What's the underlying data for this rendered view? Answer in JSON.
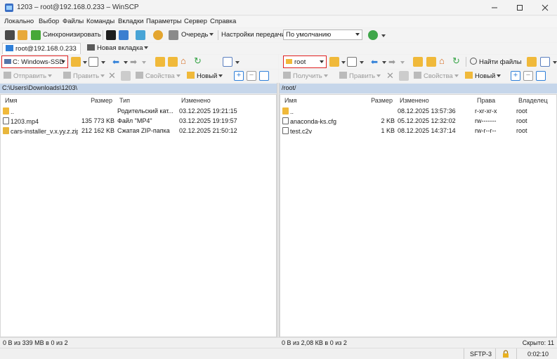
{
  "window": {
    "title": "1203 – root@192.168.0.233 – WinSCP",
    "controls": [
      "minimize",
      "maximize",
      "close"
    ]
  },
  "menu": [
    "Локально",
    "Выбор",
    "Файлы",
    "Команды",
    "Вкладки",
    "Параметры",
    "Сервер",
    "Справка"
  ],
  "toolbar": {
    "sync_label": "Синхронизировать",
    "queue_label": "Очередь",
    "transfer_settings_label": "Настройки передачи",
    "transfer_preset_value": "По умолчанию"
  },
  "tabs": {
    "active_label": "root@192.168.0.233",
    "new_tab_label": "Новая вкладка"
  },
  "left_panel": {
    "drive_value": "C: Windows-SSD",
    "send_label": "Отправить",
    "edit_label": "Править",
    "properties_label": "Свойства",
    "new_label": "Новый",
    "path": "C:\\Users\\Downloads\\1203\\",
    "columns": [
      "Имя",
      "Размер",
      "Тип",
      "Изменено"
    ],
    "rows": [
      {
        "name": "..",
        "size": "",
        "type": "Родительский кат...",
        "modified": "03.12.2025 19:21:15",
        "icon": "folder-up-icon"
      },
      {
        "name": "1203.mp4",
        "size": "135 773 KB",
        "type": "Файл \"MP4\"",
        "modified": "03.12.2025 19:19:57",
        "icon": "video-file-icon"
      },
      {
        "name": "cars-installer_v.x.yy.z.zip",
        "size": "212 162 KB",
        "type": "Сжатая ZIP-папка",
        "modified": "02.12.2025 21:50:12",
        "icon": "zip-file-icon"
      }
    ],
    "status": "0 В из 339 МВ в 0 из 2"
  },
  "right_panel": {
    "dir_value": "root",
    "find_files_label": "Найти файлы",
    "receive_label": "Получить",
    "edit_label": "Править",
    "properties_label": "Свойства",
    "new_label": "Новый",
    "path": "/root/",
    "columns": [
      "Имя",
      "Размер",
      "Изменено",
      "Права",
      "Владелец"
    ],
    "rows": [
      {
        "name": "..",
        "size": "",
        "modified": "08.12.2025 13:57:36",
        "rights": "r-xr-xr-x",
        "owner": "root",
        "icon": "folder-up-icon"
      },
      {
        "name": "anaconda-ks.cfg",
        "size": "2 KB",
        "modified": "05.12.2025 12:32:02",
        "rights": "rw-------",
        "owner": "root",
        "icon": "config-file-icon"
      },
      {
        "name": "test.c2v",
        "size": "1 KB",
        "modified": "08.12.2025 14:37:14",
        "rights": "rw-r--r--",
        "owner": "root",
        "icon": "text-file-icon"
      }
    ],
    "status": "0 В из 2,08 КВ в 0 из 2",
    "hidden": "Скрыто: 11"
  },
  "bottom": {
    "protocol": "SFTP-3",
    "elapsed": "0:02:10"
  },
  "colors": {
    "path_bar": "#c6d6ea",
    "highlight_outline": "#e02020",
    "folder": "#f0b93a",
    "accent_blue": "#2f7fd8",
    "sync_green": "#46a838"
  }
}
